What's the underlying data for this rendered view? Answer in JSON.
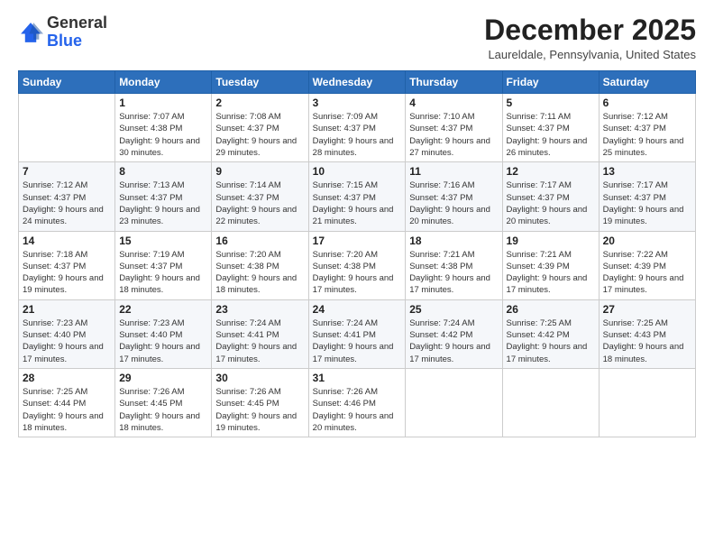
{
  "logo": {
    "general": "General",
    "blue": "Blue"
  },
  "header": {
    "month": "December 2025",
    "location": "Laureldale, Pennsylvania, United States"
  },
  "weekdays": [
    "Sunday",
    "Monday",
    "Tuesday",
    "Wednesday",
    "Thursday",
    "Friday",
    "Saturday"
  ],
  "weeks": [
    [
      {
        "day": "",
        "sunrise": "",
        "sunset": "",
        "daylight": ""
      },
      {
        "day": "1",
        "sunrise": "Sunrise: 7:07 AM",
        "sunset": "Sunset: 4:38 PM",
        "daylight": "Daylight: 9 hours and 30 minutes."
      },
      {
        "day": "2",
        "sunrise": "Sunrise: 7:08 AM",
        "sunset": "Sunset: 4:37 PM",
        "daylight": "Daylight: 9 hours and 29 minutes."
      },
      {
        "day": "3",
        "sunrise": "Sunrise: 7:09 AM",
        "sunset": "Sunset: 4:37 PM",
        "daylight": "Daylight: 9 hours and 28 minutes."
      },
      {
        "day": "4",
        "sunrise": "Sunrise: 7:10 AM",
        "sunset": "Sunset: 4:37 PM",
        "daylight": "Daylight: 9 hours and 27 minutes."
      },
      {
        "day": "5",
        "sunrise": "Sunrise: 7:11 AM",
        "sunset": "Sunset: 4:37 PM",
        "daylight": "Daylight: 9 hours and 26 minutes."
      },
      {
        "day": "6",
        "sunrise": "Sunrise: 7:12 AM",
        "sunset": "Sunset: 4:37 PM",
        "daylight": "Daylight: 9 hours and 25 minutes."
      }
    ],
    [
      {
        "day": "7",
        "sunrise": "Sunrise: 7:12 AM",
        "sunset": "Sunset: 4:37 PM",
        "daylight": "Daylight: 9 hours and 24 minutes."
      },
      {
        "day": "8",
        "sunrise": "Sunrise: 7:13 AM",
        "sunset": "Sunset: 4:37 PM",
        "daylight": "Daylight: 9 hours and 23 minutes."
      },
      {
        "day": "9",
        "sunrise": "Sunrise: 7:14 AM",
        "sunset": "Sunset: 4:37 PM",
        "daylight": "Daylight: 9 hours and 22 minutes."
      },
      {
        "day": "10",
        "sunrise": "Sunrise: 7:15 AM",
        "sunset": "Sunset: 4:37 PM",
        "daylight": "Daylight: 9 hours and 21 minutes."
      },
      {
        "day": "11",
        "sunrise": "Sunrise: 7:16 AM",
        "sunset": "Sunset: 4:37 PM",
        "daylight": "Daylight: 9 hours and 20 minutes."
      },
      {
        "day": "12",
        "sunrise": "Sunrise: 7:17 AM",
        "sunset": "Sunset: 4:37 PM",
        "daylight": "Daylight: 9 hours and 20 minutes."
      },
      {
        "day": "13",
        "sunrise": "Sunrise: 7:17 AM",
        "sunset": "Sunset: 4:37 PM",
        "daylight": "Daylight: 9 hours and 19 minutes."
      }
    ],
    [
      {
        "day": "14",
        "sunrise": "Sunrise: 7:18 AM",
        "sunset": "Sunset: 4:37 PM",
        "daylight": "Daylight: 9 hours and 19 minutes."
      },
      {
        "day": "15",
        "sunrise": "Sunrise: 7:19 AM",
        "sunset": "Sunset: 4:37 PM",
        "daylight": "Daylight: 9 hours and 18 minutes."
      },
      {
        "day": "16",
        "sunrise": "Sunrise: 7:20 AM",
        "sunset": "Sunset: 4:38 PM",
        "daylight": "Daylight: 9 hours and 18 minutes."
      },
      {
        "day": "17",
        "sunrise": "Sunrise: 7:20 AM",
        "sunset": "Sunset: 4:38 PM",
        "daylight": "Daylight: 9 hours and 17 minutes."
      },
      {
        "day": "18",
        "sunrise": "Sunrise: 7:21 AM",
        "sunset": "Sunset: 4:38 PM",
        "daylight": "Daylight: 9 hours and 17 minutes."
      },
      {
        "day": "19",
        "sunrise": "Sunrise: 7:21 AM",
        "sunset": "Sunset: 4:39 PM",
        "daylight": "Daylight: 9 hours and 17 minutes."
      },
      {
        "day": "20",
        "sunrise": "Sunrise: 7:22 AM",
        "sunset": "Sunset: 4:39 PM",
        "daylight": "Daylight: 9 hours and 17 minutes."
      }
    ],
    [
      {
        "day": "21",
        "sunrise": "Sunrise: 7:23 AM",
        "sunset": "Sunset: 4:40 PM",
        "daylight": "Daylight: 9 hours and 17 minutes."
      },
      {
        "day": "22",
        "sunrise": "Sunrise: 7:23 AM",
        "sunset": "Sunset: 4:40 PM",
        "daylight": "Daylight: 9 hours and 17 minutes."
      },
      {
        "day": "23",
        "sunrise": "Sunrise: 7:24 AM",
        "sunset": "Sunset: 4:41 PM",
        "daylight": "Daylight: 9 hours and 17 minutes."
      },
      {
        "day": "24",
        "sunrise": "Sunrise: 7:24 AM",
        "sunset": "Sunset: 4:41 PM",
        "daylight": "Daylight: 9 hours and 17 minutes."
      },
      {
        "day": "25",
        "sunrise": "Sunrise: 7:24 AM",
        "sunset": "Sunset: 4:42 PM",
        "daylight": "Daylight: 9 hours and 17 minutes."
      },
      {
        "day": "26",
        "sunrise": "Sunrise: 7:25 AM",
        "sunset": "Sunset: 4:42 PM",
        "daylight": "Daylight: 9 hours and 17 minutes."
      },
      {
        "day": "27",
        "sunrise": "Sunrise: 7:25 AM",
        "sunset": "Sunset: 4:43 PM",
        "daylight": "Daylight: 9 hours and 18 minutes."
      }
    ],
    [
      {
        "day": "28",
        "sunrise": "Sunrise: 7:25 AM",
        "sunset": "Sunset: 4:44 PM",
        "daylight": "Daylight: 9 hours and 18 minutes."
      },
      {
        "day": "29",
        "sunrise": "Sunrise: 7:26 AM",
        "sunset": "Sunset: 4:45 PM",
        "daylight": "Daylight: 9 hours and 18 minutes."
      },
      {
        "day": "30",
        "sunrise": "Sunrise: 7:26 AM",
        "sunset": "Sunset: 4:45 PM",
        "daylight": "Daylight: 9 hours and 19 minutes."
      },
      {
        "day": "31",
        "sunrise": "Sunrise: 7:26 AM",
        "sunset": "Sunset: 4:46 PM",
        "daylight": "Daylight: 9 hours and 20 minutes."
      },
      {
        "day": "",
        "sunrise": "",
        "sunset": "",
        "daylight": ""
      },
      {
        "day": "",
        "sunrise": "",
        "sunset": "",
        "daylight": ""
      },
      {
        "day": "",
        "sunrise": "",
        "sunset": "",
        "daylight": ""
      }
    ]
  ]
}
